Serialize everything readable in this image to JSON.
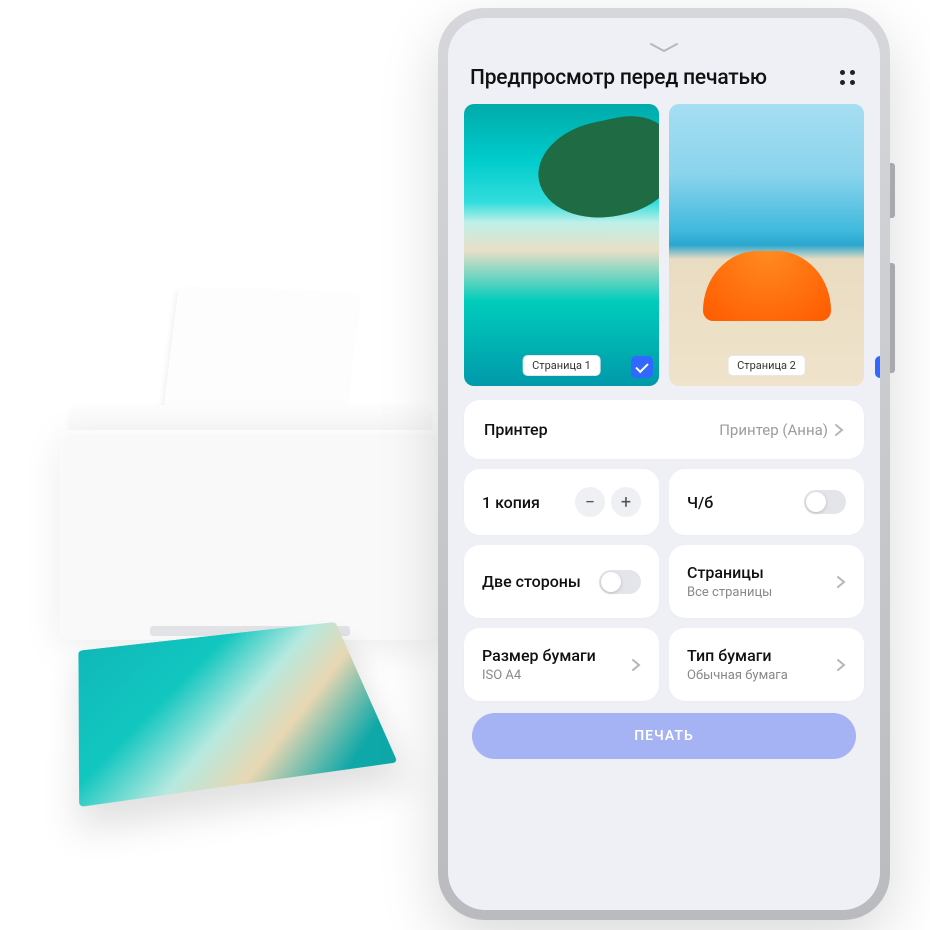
{
  "header": {
    "title": "Предпросмотр перед печатью"
  },
  "pages": [
    {
      "label": "Страница 1",
      "selected": true
    },
    {
      "label": "Страница 2",
      "selected": false
    }
  ],
  "printer_row": {
    "label": "Принтер",
    "value": "Принтер (Анна)"
  },
  "copies": {
    "label": "1 копия"
  },
  "bw": {
    "label": "Ч/б",
    "on": false
  },
  "duplex": {
    "label": "Две стороны",
    "on": false
  },
  "pages_setting": {
    "label": "Страницы",
    "value": "Все страницы"
  },
  "paper_size": {
    "label": "Размер бумаги",
    "value": "ISO A4"
  },
  "paper_type": {
    "label": "Тип бумаги",
    "value": "Обычная бумага"
  },
  "print_button": "ПЕЧАТЬ"
}
